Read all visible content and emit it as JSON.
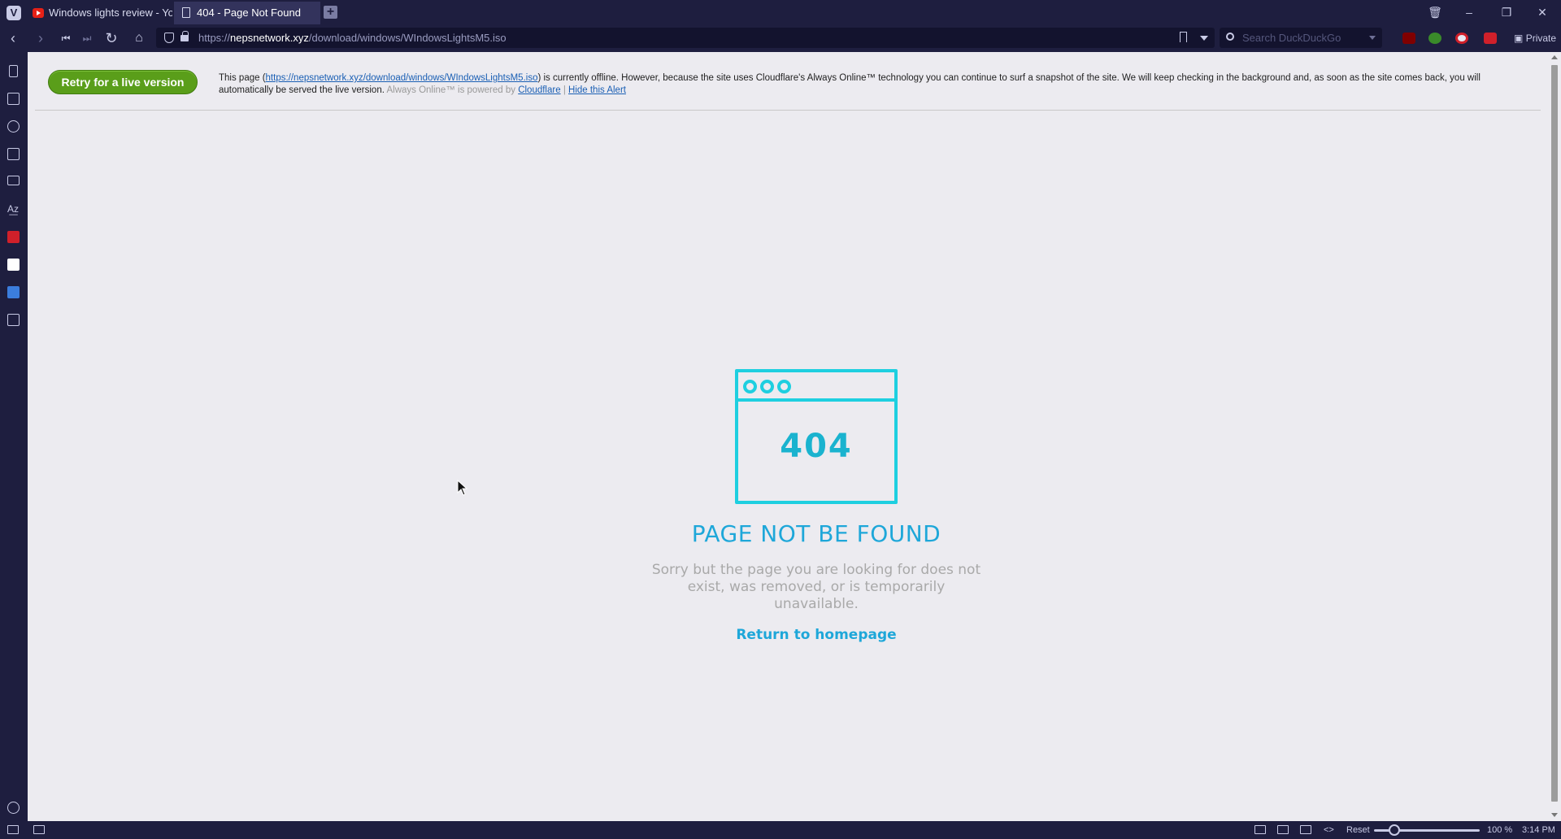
{
  "browser": {
    "logo": "V",
    "tabs": [
      {
        "title": "Windows lights review - Yo",
        "icon": "youtube-icon",
        "active": false
      },
      {
        "title": "404 - Page Not Found",
        "icon": "document-icon",
        "active": true
      }
    ],
    "new_tab_label": "+",
    "url": {
      "prefix": "https://",
      "host": "nepsnetwork.xyz",
      "path": "/download/windows/WIndowsLightsM5.iso"
    },
    "search_placeholder": "Search DuckDuckGo",
    "private_label": "Private"
  },
  "cloudflare_bar": {
    "retry_label": "Retry for a live version",
    "msg_prefix": "This page (",
    "msg_link": "https://nepsnetwork.xyz/download/windows/WIndowsLightsM5.iso",
    "msg_body": ") is currently offline. However, because the site uses Cloudflare's Always Online™ technology you can continue to surf a snapshot of the site. We will keep checking in the background and, as soon as the site comes back, you will automatically be served the live version.",
    "msg_powered": "Always Online™ is powered by",
    "cloudflare_link": "Cloudflare",
    "separator": "|",
    "hide_link": "Hide this Alert"
  },
  "not_found": {
    "code": "404",
    "title": "PAGE NOT BE FOUND",
    "description": "Sorry but the page you are looking for does not exist, was removed, or is temporarily unavailable.",
    "return_link": "Return to homepage"
  },
  "statusbar": {
    "reset_label": "Reset",
    "zoom": "100 %",
    "time": "3:14 PM"
  },
  "colors": {
    "browser_chrome": "#1e1e3f",
    "page_bg": "#ecebf0",
    "accent_cyan": "#1ecfe0",
    "accent_blue": "#1ea7d9",
    "retry_green": "#5a9e1a"
  }
}
